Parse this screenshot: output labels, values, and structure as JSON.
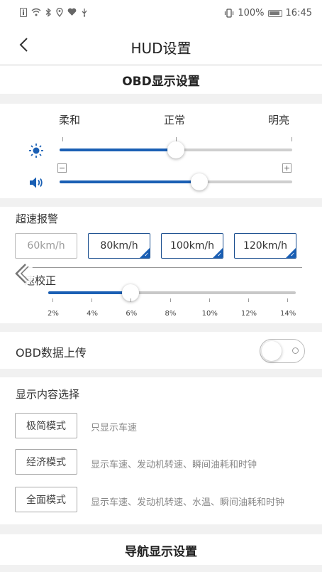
{
  "status_bar": {
    "left_icons": [
      "info-icon",
      "wifi-icon",
      "bluetooth-icon",
      "location-icon",
      "heart-icon",
      "usb-icon"
    ],
    "battery_percent": "100%",
    "time": "16:45"
  },
  "header": {
    "title": "HUD设置"
  },
  "obd_section": {
    "title": "OBD显示设置",
    "brightness_labels": [
      "柔和",
      "正常",
      "明亮"
    ],
    "brightness_level": 0.5,
    "volume_level": 0.6,
    "volume_minus": "−",
    "volume_plus": "+"
  },
  "speed_alarm": {
    "label": "超速报警",
    "options": [
      {
        "label": "60km/h",
        "selected": false
      },
      {
        "label": "80km/h",
        "selected": true
      },
      {
        "label": "100km/h",
        "selected": true
      },
      {
        "label": "120km/h",
        "selected": true
      }
    ]
  },
  "speed_calibration": {
    "label": "车速校正",
    "visible_label": "速校正",
    "ticks": [
      "2%",
      "4%",
      "6%",
      "8%",
      "10%",
      "12%",
      "14%"
    ],
    "value": "6%"
  },
  "obd_upload": {
    "label": "OBD数据上传",
    "enabled": false
  },
  "display_content": {
    "label": "显示内容选择",
    "modes": [
      {
        "label": "极简模式",
        "desc": "只显示车速"
      },
      {
        "label": "经济模式",
        "desc": "显示车速、发动机转速、瞬间油耗和时钟"
      },
      {
        "label": "全面模式",
        "desc": "显示车速、发动机转速、水温、瞬间油耗和时钟"
      }
    ]
  },
  "nav_section": {
    "title": "导航显示设置"
  },
  "colors": {
    "accent": "#1a5fb4",
    "border_selected": "#1a4e8f",
    "divider": "#f1f1f1"
  }
}
